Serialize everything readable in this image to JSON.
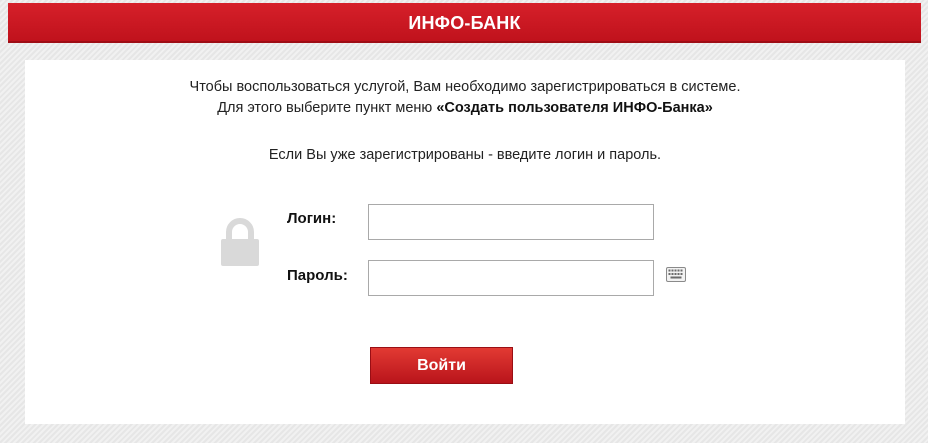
{
  "header": {
    "title": "ИНФО-БАНК"
  },
  "info": {
    "line1": "Чтобы воспользоваться услугой, Вам необходимо зарегистрироваться в системе.",
    "line2_prefix": "Для этого выберите пункт меню ",
    "line2_bold": "«Создать пользователя ИНФО-Банка»",
    "line3": "Если Вы уже зарегистрированы - введите логин и пароль."
  },
  "form": {
    "login_label": "Логин:",
    "login_value": "",
    "password_label": "Пароль:",
    "password_value": "",
    "submit_label": "Войти"
  },
  "icons": {
    "lock": "lock-icon",
    "virtual_keyboard": "keyboard-icon"
  },
  "colors": {
    "brand_red": "#c0121c",
    "lock_gray": "#d9d9d9"
  }
}
